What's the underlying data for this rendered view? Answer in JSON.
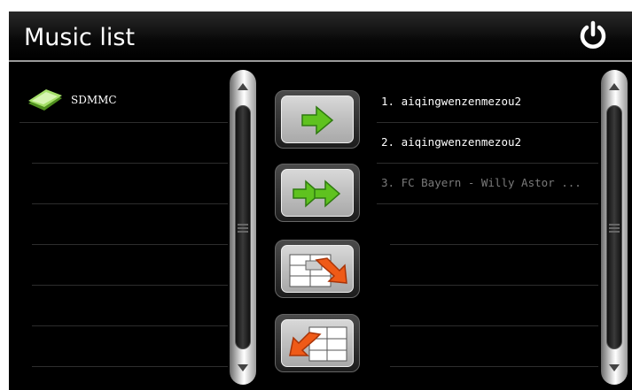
{
  "title": "Music list",
  "icons": {
    "power": "power-icon",
    "device": "sd-card-icon",
    "add": "arrow-right-icon",
    "add_all": "double-arrow-right-icon",
    "remove": "remove-from-list-icon",
    "remove_all": "clear-list-icon",
    "scroll_up": "scroll-up-arrow-icon",
    "scroll_down": "scroll-down-arrow-icon"
  },
  "devices": [
    {
      "label": "SDMMC"
    }
  ],
  "playlist": [
    {
      "label": "1. aiqingwenzenmezou2"
    },
    {
      "label": "2. aiqingwenzenmezou2"
    },
    {
      "label": "3. FC Bayern - Willy Astor ..."
    }
  ],
  "colors": {
    "accent_green": "#5fc21f",
    "remove_orange": "#ef5a17",
    "text": "#ffffff",
    "dim_text": "#7a7a7a"
  }
}
